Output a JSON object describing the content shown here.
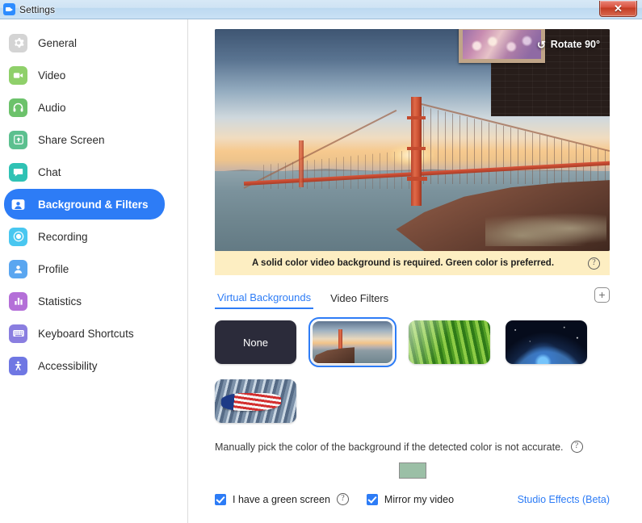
{
  "window": {
    "title": "Settings",
    "close_label": "✕",
    "logo_icon": "zoom-logo-icon"
  },
  "sidebar": {
    "items": [
      {
        "label": "General",
        "icon": "gear-icon",
        "color": "#d4d4d4",
        "active": false
      },
      {
        "label": "Video",
        "icon": "camera-icon",
        "color": "#8fd06a",
        "active": false
      },
      {
        "label": "Audio",
        "icon": "headphones-icon",
        "color": "#6cc26b",
        "active": false
      },
      {
        "label": "Share Screen",
        "icon": "upload-icon",
        "color": "#5cc08f",
        "active": false
      },
      {
        "label": "Chat",
        "icon": "chat-icon",
        "color": "#2fc2b4",
        "active": false
      },
      {
        "label": "Background & Filters",
        "icon": "person-icon",
        "color": "#ffffff",
        "active": true
      },
      {
        "label": "Recording",
        "icon": "record-icon",
        "color": "#49c7f0",
        "active": false
      },
      {
        "label": "Profile",
        "icon": "profile-icon",
        "color": "#5aa6f0",
        "active": false
      },
      {
        "label": "Statistics",
        "icon": "bars-icon",
        "color": "#b46fd8",
        "active": false
      },
      {
        "label": "Keyboard Shortcuts",
        "icon": "keyboard-icon",
        "color": "#8a7ee0",
        "active": false
      },
      {
        "label": "Accessibility",
        "icon": "accessibility-icon",
        "color": "#6f77e3",
        "active": false
      }
    ]
  },
  "preview": {
    "rotate_label": "Rotate 90°",
    "rotate_icon": "rotate-ccw-icon"
  },
  "notice": {
    "text": "A solid color video background is required. Green color is preferred.",
    "help_icon": "question-mark-icon",
    "help_glyph": "?",
    "bg_color": "#fdeec2"
  },
  "tabs": [
    {
      "label": "Virtual Backgrounds",
      "active": true
    },
    {
      "label": "Video Filters",
      "active": false
    }
  ],
  "add_button": {
    "glyph": "+",
    "icon": "plus-icon"
  },
  "backgrounds": [
    {
      "label": "None",
      "style": "thumb-none",
      "selected": false
    },
    {
      "label": "Golden Gate Bridge",
      "style": "tb-bridge",
      "selected": true
    },
    {
      "label": "Grass",
      "style": "tb-grass",
      "selected": false
    },
    {
      "label": "Earth from Space",
      "style": "tb-space",
      "selected": false
    },
    {
      "label": "Flag and Building",
      "style": "tb-flag",
      "selected": false
    }
  ],
  "manual": {
    "text": "Manually pick the color of the background if the detected color is not accurate.",
    "help_glyph": "?",
    "swatch_color": "#9bbfa6"
  },
  "options": [
    {
      "label": "I have a green screen",
      "checked": true,
      "has_help": true
    },
    {
      "label": "Mirror my video",
      "checked": true,
      "has_help": false
    }
  ],
  "studio_effects": {
    "label": "Studio Effects (Beta)"
  },
  "colors": {
    "accent": "#2d7cf6",
    "notice_bg": "#fdeec2",
    "titlebar": "#cfe3f4",
    "close_red": "#c33a22"
  }
}
